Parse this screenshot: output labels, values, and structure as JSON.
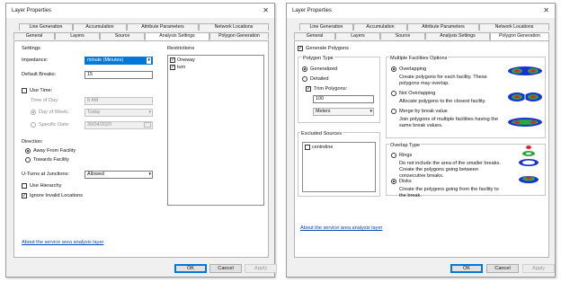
{
  "dialog1": {
    "title": "Layer Properties",
    "close": "✕",
    "tabs_top": [
      "Line Generation",
      "Accumulation",
      "Attribute Parameters",
      "Network Locations"
    ],
    "tabs_bottom": [
      "General",
      "Layers",
      "Source",
      "Analysis Settings",
      "Polygon Generation"
    ],
    "active_tab": "Analysis Settings",
    "settings_header": "Settings",
    "impedance_label": "Impedance:",
    "impedance_value": "minute (Minutes)",
    "default_breaks_label": "Default Breaks:",
    "default_breaks_value": "15",
    "use_time_label": "Use Time:",
    "time_of_day_label": "Time of Day:",
    "time_of_day_value": "8 AM",
    "day_of_week_label": "Day of Week:",
    "day_of_week_value": "Today",
    "specific_date_label": "Specific Date:",
    "specific_date_value": "30/04/2020",
    "direction_label": "Direction:",
    "away_label": "Away From Facility",
    "towards_label": "Towards Facility",
    "uturns_label": "U-Turns at Junctions:",
    "uturns_value": "Allowed",
    "hierarchy_label": "Use Hierarchy",
    "ignore_label": "Ignore Invalid Locations",
    "restrictions_header": "Restrictions",
    "restrictions": [
      "Oneway",
      "turn"
    ],
    "about_link": "About the service area analysis layer",
    "ok": "OK",
    "cancel": "Cancel",
    "apply": "Apply"
  },
  "dialog2": {
    "title": "Layer Properties",
    "close": "✕",
    "tabs_top": [
      "Line Generation",
      "Accumulation",
      "Attribute Parameters",
      "Network Locations"
    ],
    "tabs_bottom": [
      "General",
      "Layers",
      "Source",
      "Analysis Settings",
      "Polygon Generation"
    ],
    "active_tab": "Polygon Generation",
    "generate_label": "Generate Polygons",
    "polygon_type_header": "Polygon Type",
    "generalized_label": "Generalized",
    "detailed_label": "Detailed",
    "trim_label": "Trim Polygons:",
    "trim_value": "100",
    "trim_units": "Meters",
    "excluded_header": "Excluded Sources",
    "excluded_items": [
      "centreline"
    ],
    "mfo_header": "Multiple Facilities Options",
    "overlapping_label": "Overlapping",
    "overlapping_desc1": "Create polygons for each facility. These",
    "overlapping_desc2": "polygons may overlap.",
    "not_overlapping_label": "Not Overlapping",
    "not_overlapping_desc": "Allocate polygons to the closest facility.",
    "merge_label": "Merge by break value",
    "merge_desc1": "Join polygons of multiple facilities having the",
    "merge_desc2": "same break values.",
    "overlap_type_header": "Overlap Type",
    "rings_label": "Rings",
    "rings_desc1": "Do not include the area of the smaller breaks.",
    "rings_desc2": "Create the polygons going between",
    "rings_desc3": "consecutive breaks.",
    "disks_label": "Disks",
    "disks_desc1": "Create the polygons going from the facility to",
    "disks_desc2": "the break.",
    "about_link": "About the service area analysis layer",
    "ok": "OK",
    "cancel": "Cancel",
    "apply": "Apply"
  },
  "colors": {
    "selection": "#0078d7",
    "polygon_blue": "#1a2fd6",
    "polygon_red": "#d42a2a",
    "polygon_green": "#27a83a"
  }
}
